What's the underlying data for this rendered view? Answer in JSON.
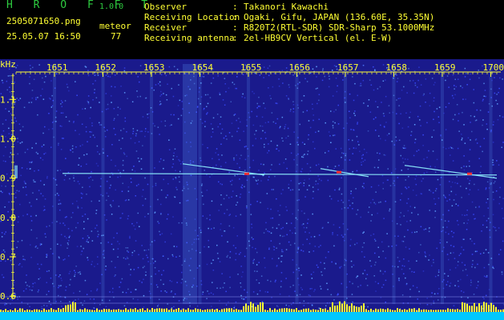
{
  "header": {
    "app_title": "H R O F F T",
    "version": "1.0.0",
    "file_name": "2505071650.png",
    "timestamp": "25.05.07 16:50",
    "count_label": "meteor",
    "count_value": "77",
    "info": [
      {
        "key": "Observer",
        "value": "Takanori Kawachi"
      },
      {
        "key": "Receiving Location",
        "value": "Ogaki, Gifu, JAPAN (136.60E, 35.35N)"
      },
      {
        "key": "Receiver",
        "value": "R820T2(RTL-SDR) SDR-Sharp 53.1000MHz"
      },
      {
        "key": "Receiving antenna",
        "value": "2el-HB9CV Vertical (el. E-W)"
      }
    ]
  },
  "colors": {
    "background": "#1a1a8c",
    "noise_a": "#3a4cff",
    "noise_b": "#5fa0ff",
    "signal": "#8ff0ff",
    "hot": "#ff3030",
    "axis_text": "#ffff33",
    "baseline_fill": "#00c8ff",
    "baseline_peaks": "#ffff33",
    "title_green": "#2ecc40"
  },
  "chart_data": {
    "type": "heatmap",
    "ylabel": "kHz",
    "y_ticks": [
      "1.1",
      "1.0",
      "0.9",
      "0.8",
      "0.7",
      "0.6"
    ],
    "x_ticks": [
      "1651",
      "1652",
      "1653",
      "1654",
      "1655",
      "1656",
      "1657",
      "1658",
      "1659",
      "1700"
    ],
    "ylim": [
      0.58,
      1.19
    ],
    "xlim_minutes": [
      0,
      10
    ],
    "carrier_freq_khz": 0.912,
    "meteor_count": 77
  }
}
